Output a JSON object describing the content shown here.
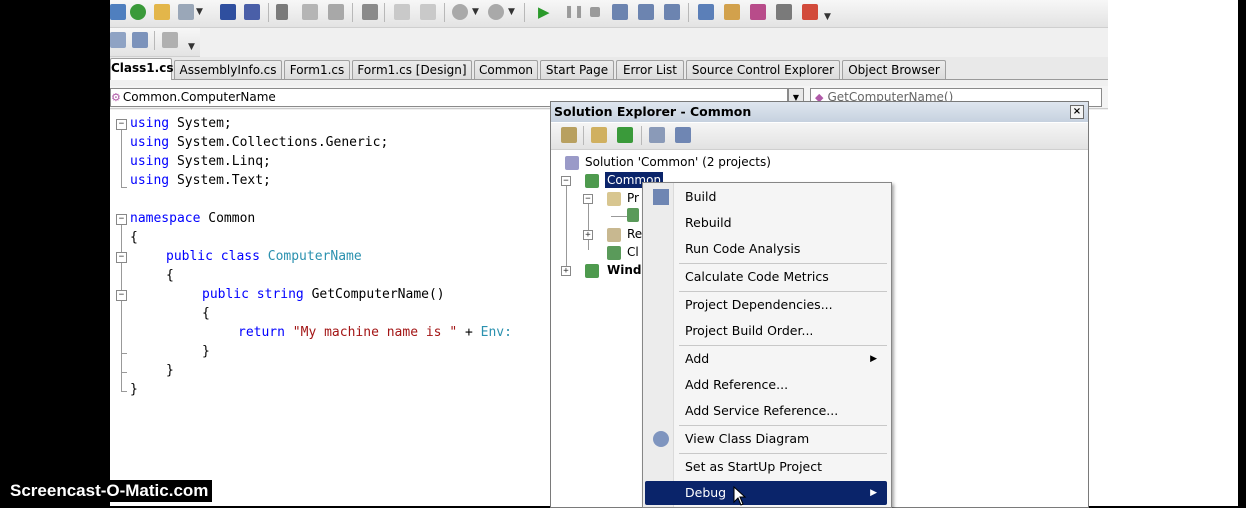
{
  "tabs": [
    {
      "label": "Class1.cs",
      "active": true
    },
    {
      "label": "AssemblyInfo.cs"
    },
    {
      "label": "Form1.cs"
    },
    {
      "label": "Form1.cs [Design]"
    },
    {
      "label": "Common"
    },
    {
      "label": "Start Page"
    },
    {
      "label": "Error List"
    },
    {
      "label": "Source Control Explorer"
    },
    {
      "label": "Object Browser"
    }
  ],
  "navbar": {
    "type_combo": "Common.ComputerName",
    "member_combo": "GetComputerName()"
  },
  "code": {
    "l1_kw": "using",
    "l1_rest": " System;",
    "l2_kw": "using",
    "l2_rest": " System.Collections.Generic;",
    "l3_kw": "using",
    "l3_rest": " System.Linq;",
    "l4_kw": "using",
    "l4_rest": " System.Text;",
    "l6_kw": "namespace",
    "l6_rest": " Common",
    "l7": "{",
    "l8_kw": "public class",
    "l8_type": "ComputerName",
    "l9": "{",
    "l10_kw": "public string",
    "l10_rest": " GetComputerName()",
    "l11": "{",
    "l12_kw": "return",
    "l12_str": "\"My machine name is \"",
    "l12_rest": " + ",
    "l12_type": "Env:",
    "l13": "}",
    "l14": "}",
    "l15": "}"
  },
  "solution_explorer": {
    "title": "Solution Explorer - Common",
    "close": "×",
    "tree": {
      "solution": "Solution 'Common' (2 projects)",
      "project_common": "Common",
      "properties": "Pr",
      "references": "Re",
      "class_file": "Cl",
      "project_windows": "Windo"
    }
  },
  "context_menu": {
    "items": {
      "build": "Build",
      "rebuild": "Rebuild",
      "run_code_analysis": "Run Code Analysis",
      "calculate_code_metrics": "Calculate Code Metrics",
      "project_dependencies": "Project Dependencies...",
      "project_build_order": "Project Build Order...",
      "add": "Add",
      "add_reference": "Add Reference...",
      "add_service_reference": "Add Service Reference...",
      "view_class_diagram": "View Class Diagram",
      "set_startup": "Set as StartUp Project",
      "debug": "Debug"
    },
    "submenu_arrow": "▶",
    "selected": "debug"
  },
  "watermark": "Screencast-O-Matic.com",
  "colors": {
    "keyword": "#0000ff",
    "type": "#2b91af",
    "string": "#a31515",
    "menu_highlight": "#0a246a"
  }
}
